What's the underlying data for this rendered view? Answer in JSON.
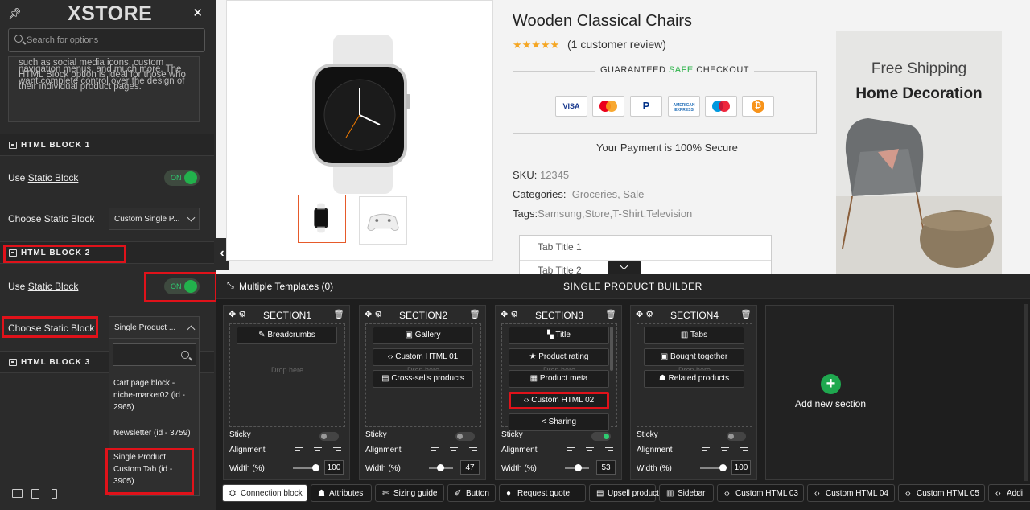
{
  "sidebar": {
    "logo": "XSTORE",
    "search_placeholder": "Search for options",
    "description": [
      "such as social media icons, custom",
      "navigation menus, and much more. The",
      "HTML Block option is ideal for those who",
      "want complete control over the design of",
      "their individual product pages."
    ],
    "html_block_1": "HTML BLOCK 1",
    "html_block_2": "HTML BLOCK 2",
    "html_block_3": "HTML BLOCK 3",
    "use_prefix": "Use ",
    "static_block_link": "Static Block",
    "toggle_on": "ON",
    "choose_label": "Choose Static Block",
    "choose1_value": "Custom Single P...",
    "choose2_value": "Single Product ...",
    "dropdown_options": [
      [
        "Cart page block -",
        "niche-market02 (id -",
        "2965)"
      ],
      [
        "Newsletter (id - 3759)"
      ],
      [
        "Single Product",
        "Custom Tab (id -",
        "3905)"
      ]
    ]
  },
  "product": {
    "title": "Wooden Classical Chairs",
    "stars": "★★★★★",
    "reviews": "(1 customer review)",
    "guaranteed_prefix": "GUARANTEED ",
    "guaranteed_safe": "SAFE",
    "guaranteed_suffix": " CHECKOUT",
    "payments": [
      "VISA",
      "MC",
      "P",
      "AMERICAN EXPRESS",
      "MAESTRO",
      "₿"
    ],
    "secure_text": "Your Payment is 100% Secure",
    "sku_label": "SKU:",
    "sku_value": "12345",
    "categories_label": "Categories:",
    "categories": "Groceries,  Sale",
    "tags_label": "Tags:",
    "tags": "Samsung,Store,T-Shirt,Television",
    "tab_title_1": "Tab Title 1",
    "tab_title_2": "Tab Title 2"
  },
  "banner": {
    "line1": "Free Shipping",
    "line2": "Home Decoration"
  },
  "builder": {
    "multiple_templates": "Multiple Templates (0)",
    "title": "SINGLE PRODUCT BUILDER",
    "drop_here": "Drop here",
    "sticky": "Sticky",
    "alignment": "Alignment",
    "width": "Width (%)",
    "sections": [
      {
        "title": "SECTION1",
        "blocks": [
          "Breadcrumbs"
        ],
        "width": "100",
        "sticky": false
      },
      {
        "title": "SECTION2",
        "blocks": [
          "Gallery",
          "Custom HTML 01",
          "Cross-sells products"
        ],
        "width": "47",
        "sticky": false
      },
      {
        "title": "SECTION3",
        "blocks": [
          "Title",
          "Product rating",
          "Product meta",
          "Custom HTML 02",
          "Sharing"
        ],
        "width": "53",
        "sticky": true
      },
      {
        "title": "SECTION4",
        "blocks": [
          "Tabs",
          "Bought together",
          "Related products"
        ],
        "width": "100",
        "sticky": false
      }
    ],
    "add_section": "Add new section",
    "chips": [
      "Connection block",
      "Attributes",
      "Sizing guide",
      "Button",
      "Request quote",
      "Upsell products",
      "Sidebar",
      "Custom HTML 03",
      "Custom HTML 04",
      "Custom HTML 05",
      "Addi"
    ]
  }
}
